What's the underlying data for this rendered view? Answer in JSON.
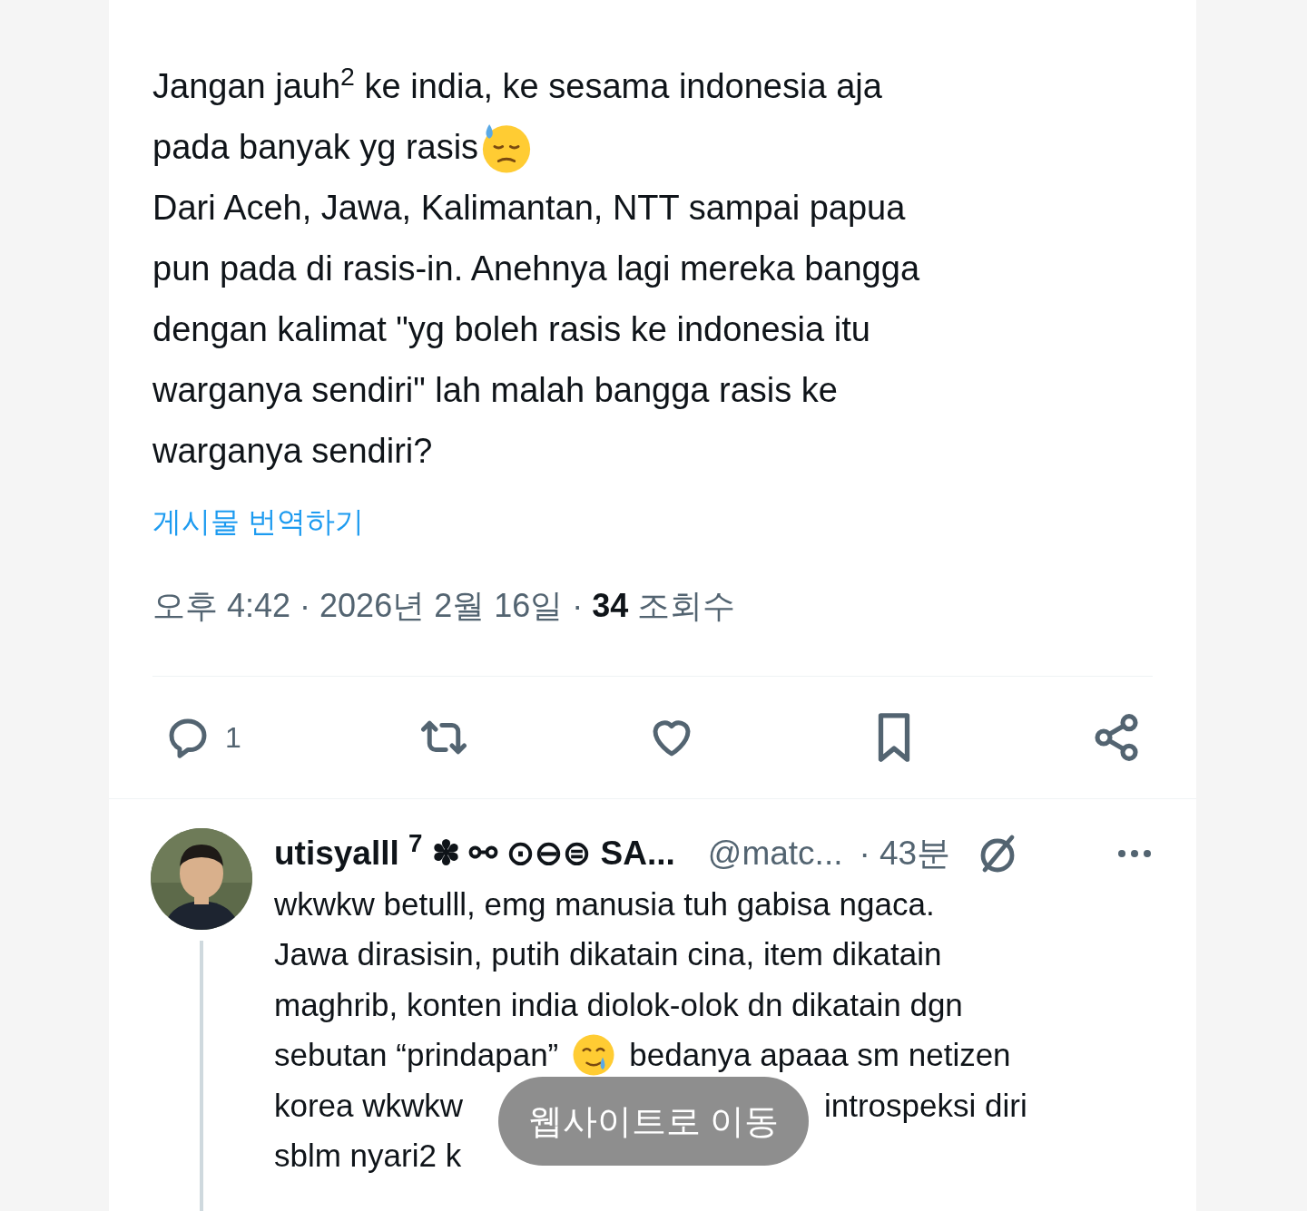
{
  "post": {
    "lines": [
      {
        "text": "Jangan jauh$^{2}$ ke india, ke sesama indonesia aja"
      },
      {
        "text": "pada banyak yg rasis",
        "kind": "sweat"
      },
      {
        "text": "Dari Aceh, Jawa, Kalimantan, NTT sampai papua"
      },
      {
        "text": "pun pada di rasis-in. Anehnya lagi mereka bangga"
      },
      {
        "text": "dengan kalimat \"yg boleh rasis ke indonesia itu"
      },
      {
        "text": "warganya sendiri\" lah malah bangga rasis ke"
      },
      {
        "text": "warganya sendiri?"
      }
    ],
    "translate_link": "게시물 번역하기",
    "time": "오후 4:42 · 2026년 2월 16일 · ",
    "views_count": "34",
    "views_label": "조회수",
    "actions": [
      {
        "kind": "reply",
        "count": "1"
      },
      {
        "kind": "repost"
      },
      {
        "kind": "like"
      },
      {
        "kind": "bookmark"
      },
      {
        "kind": "share"
      }
    ]
  },
  "reply": {
    "name": "utisyalll $^{7}$ ✽ ⚯ ⊙⊖⊜ SA...",
    "handle": "@matc...",
    "time": "· 43분",
    "lines": [
      {
        "text": "wkwkw betulll, emg manusia tuh gabisa ngaca."
      },
      {
        "text": "Jawa dirasisin, putih dikatain cina, item dikatain"
      },
      {
        "text": "maghrib, konten india diolok-olok dn dikatain dgn"
      },
      {
        "text": "sebutan “prindapan”",
        "kind": "tearful",
        "after": "bedanya apaaa sm netizen"
      },
      {
        "text": "korea wkwkw",
        "kind": "covered",
        "after": "introspeksi diri"
      },
      {
        "text": "sblm nyari2 k",
        "kind": "covered"
      }
    ]
  },
  "toast": {
    "text": "웹사이트로 이동"
  }
}
